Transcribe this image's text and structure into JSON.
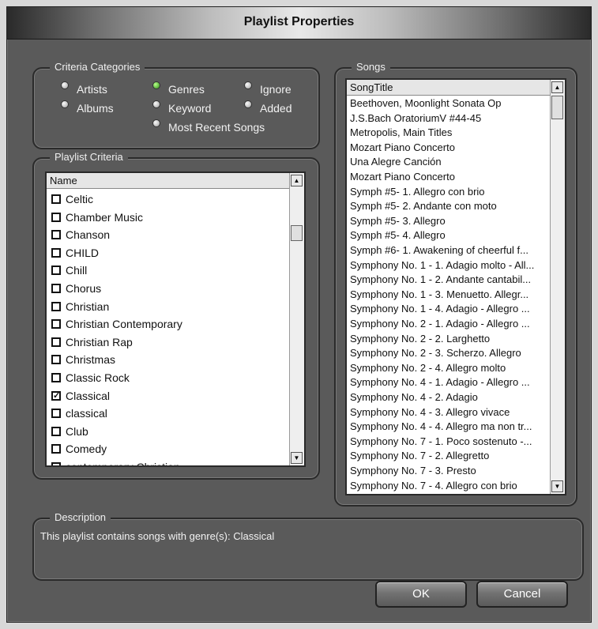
{
  "window": {
    "title": "Playlist Properties"
  },
  "criteria_categories": {
    "label": "Criteria Categories",
    "options": [
      {
        "label": "Artists",
        "selected": false
      },
      {
        "label": "Genres",
        "selected": true
      },
      {
        "label": "Ignore",
        "selected": false
      },
      {
        "label": "Albums",
        "selected": false
      },
      {
        "label": "Keyword",
        "selected": false
      },
      {
        "label": "Added",
        "selected": false
      },
      {
        "label": "Most Recent Songs",
        "selected": false
      }
    ]
  },
  "playlist_criteria": {
    "label": "Playlist Criteria",
    "column_header": "Name",
    "items": [
      {
        "label": "Celtic",
        "checked": false
      },
      {
        "label": "Chamber Music",
        "checked": false
      },
      {
        "label": "Chanson",
        "checked": false
      },
      {
        "label": "CHILD",
        "checked": false
      },
      {
        "label": "Chill",
        "checked": false
      },
      {
        "label": "Chorus",
        "checked": false
      },
      {
        "label": "Christian",
        "checked": false
      },
      {
        "label": "Christian Contemporary",
        "checked": false
      },
      {
        "label": "Christian Rap",
        "checked": false
      },
      {
        "label": "Christmas",
        "checked": false
      },
      {
        "label": "Classic Rock",
        "checked": false
      },
      {
        "label": "Classical",
        "checked": true
      },
      {
        "label": "classical",
        "checked": false
      },
      {
        "label": "Club",
        "checked": false
      },
      {
        "label": "Comedy",
        "checked": false
      },
      {
        "label": "contemporary Christian",
        "checked": false
      }
    ]
  },
  "songs": {
    "label": "Songs",
    "column_header": "SongTitle",
    "items": [
      "Beethoven, Moonlight Sonata Op",
      "J.S.Bach OratoriumV #44-45",
      "Metropolis, Main Titles",
      "Mozart Piano Concerto",
      "Una Alegre Canción",
      "Mozart Piano Concerto",
      "Symph #5- 1. Allegro con brio",
      "Symph #5- 2. Andante con moto",
      "Symph #5- 3. Allegro",
      "Symph #5- 4. Allegro",
      "Symph #6- 1. Awakening of cheerful f...",
      "Symphony No. 1 - 1. Adagio molto - All...",
      "Symphony No. 1 - 2. Andante cantabil...",
      "Symphony No. 1 - 3. Menuetto. Allegr...",
      "Symphony No. 1 - 4. Adagio - Allegro ...",
      "Symphony No. 2 - 1. Adagio - Allegro ...",
      "Symphony No. 2 - 2. Larghetto",
      "Symphony No. 2 - 3. Scherzo. Allegro",
      "Symphony No. 2 - 4. Allegro molto",
      "Symphony No. 4 - 1. Adagio - Allegro ...",
      "Symphony No. 4 - 2. Adagio",
      "Symphony No. 4 - 3. Allegro vivace",
      "Symphony No. 4 - 4. Allegro ma non tr...",
      "Symphony No. 7 - 1. Poco sostenuto -...",
      "Symphony No. 7 - 2. Allegretto",
      "Symphony No. 7 - 3. Presto",
      "Symphony No. 7 - 4. Allegro con brio"
    ]
  },
  "description": {
    "label": "Description",
    "text": "This playlist contains songs with genre(s): Classical"
  },
  "buttons": {
    "ok": "OK",
    "cancel": "Cancel"
  },
  "icons": {
    "scroll_up": "arrow-up-icon",
    "scroll_down": "arrow-down-icon",
    "radio": "radio-dot-icon",
    "checkbox": "checkbox-icon"
  }
}
